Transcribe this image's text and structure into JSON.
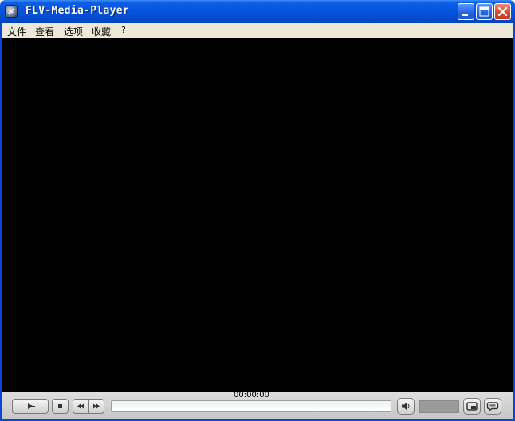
{
  "window": {
    "title": "FLV-Media-Player",
    "icons": {
      "app": "player-app-icon",
      "minimize": "minimize-icon",
      "maximize": "maximize-icon",
      "close": "close-icon"
    }
  },
  "menu": {
    "items": [
      "文件",
      "查看",
      "选项",
      "收藏",
      "?"
    ]
  },
  "player": {
    "time": "00:00:00",
    "progress": 0,
    "icons": {
      "play": "play-icon",
      "stop": "stop-icon",
      "rewind": "rewind-icon",
      "forward": "fast-forward-icon",
      "volume": "speaker-icon",
      "fullscreen": "window-mode-icon",
      "chat": "chat-bubble-icon"
    }
  },
  "colors": {
    "titlebar": "#0553dd",
    "menubar": "#ece9d8",
    "video": "#000000",
    "controls": "#cfcfcf"
  }
}
